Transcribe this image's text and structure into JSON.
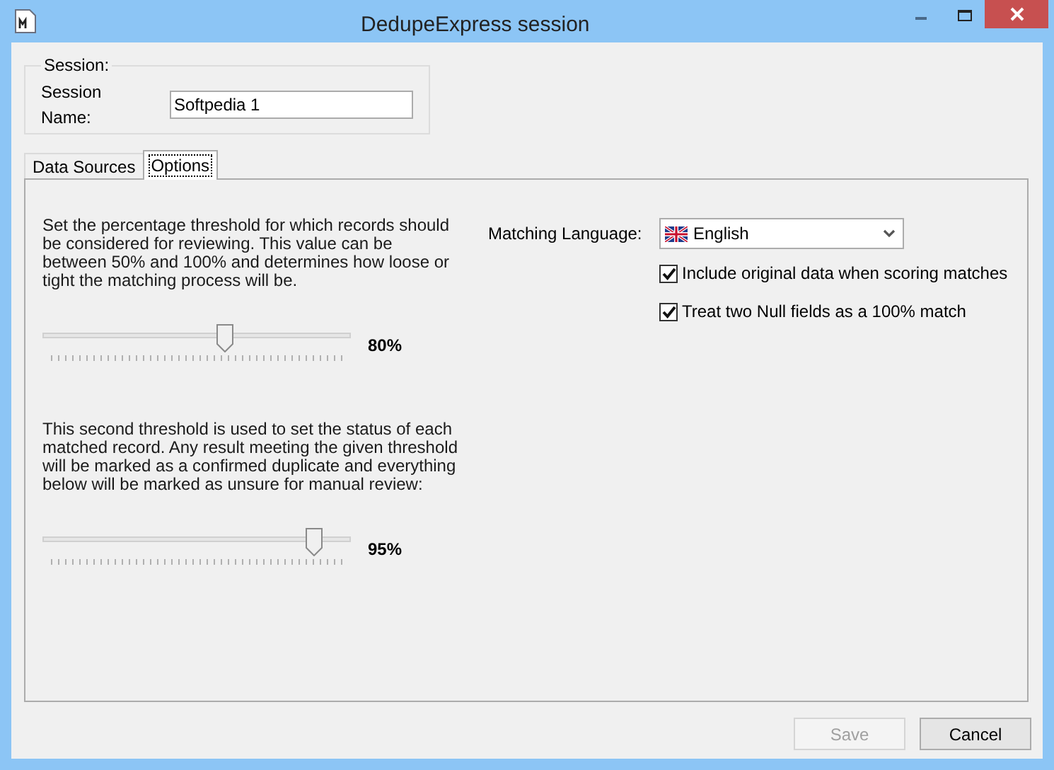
{
  "window": {
    "title": "DedupeExpress session"
  },
  "session": {
    "legend": "Session:",
    "name_label": "Session Name:",
    "name_value": "Softpedia 1"
  },
  "tabs": [
    {
      "label": "Data Sources",
      "selected": false
    },
    {
      "label": "Options",
      "selected": true
    }
  ],
  "options": {
    "thresholds": [
      {
        "description": "Set the percentage threshold for which records should be considered for reviewing. This value can be between 50% and 100% and determines how loose or tight the matching process will be.",
        "level": 0.59,
        "reading": "80%"
      },
      {
        "description": "This second threshold is used to set the status of each matched record. Any result meeting the given threshold will be marked as a confirmed duplicate and everything below will be marked as unsure for manual review:",
        "level": 0.88,
        "reading": "95%"
      }
    ],
    "language": {
      "label": "Matching Language:",
      "value": "English"
    },
    "checkboxes": [
      {
        "label": "Include original data when scoring matches",
        "checked": true
      },
      {
        "label": "Treat two Null fields as a 100% match",
        "checked": true
      }
    ]
  },
  "buttons": [
    {
      "label": "Save",
      "disabled": true
    },
    {
      "label": "Cancel",
      "disabled": false
    }
  ]
}
